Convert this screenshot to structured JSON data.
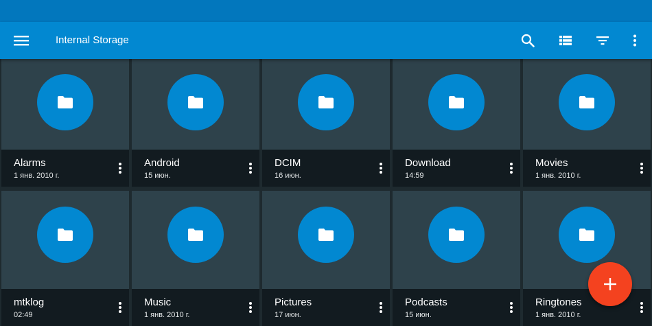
{
  "app_bar": {
    "title": "Internal Storage",
    "color": "#0288d1",
    "status_bar_color": "#0277bd",
    "actions": [
      "search-icon",
      "list-view-icon",
      "filter-icon",
      "overflow-menu-icon"
    ]
  },
  "folders": [
    {
      "name": "Alarms",
      "date": "1 янв. 2010 г."
    },
    {
      "name": "Android",
      "date": "15 июн."
    },
    {
      "name": "DCIM",
      "date": "16 июн."
    },
    {
      "name": "Download",
      "date": "14:59"
    },
    {
      "name": "Movies",
      "date": "1 янв. 2010 г."
    },
    {
      "name": "mtklog",
      "date": "02:49"
    },
    {
      "name": "Music",
      "date": "1 янв. 2010 г."
    },
    {
      "name": "Pictures",
      "date": "17 июн."
    },
    {
      "name": "Podcasts",
      "date": "15 июн."
    },
    {
      "name": "Ringtones",
      "date": "1 янв. 2010 г."
    }
  ],
  "fab": {
    "icon": "add-icon",
    "color": "#f4421f"
  }
}
